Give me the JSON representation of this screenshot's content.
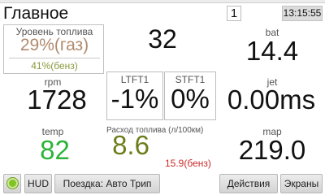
{
  "header": {
    "title": "Главное",
    "page_number": "1",
    "time": "13:15:55"
  },
  "fuel_level": {
    "label": "Уровень топлива",
    "gas_value": "29%(газ)",
    "petrol_value": "41%(бенз)"
  },
  "center_top": {
    "value": "32"
  },
  "bat": {
    "label": "bat",
    "value": "14.4"
  },
  "rpm": {
    "label": "rpm",
    "value": "1728"
  },
  "ltft1": {
    "label": "LTFT1",
    "value": "-1%"
  },
  "stft1": {
    "label": "STFT1",
    "value": "0%"
  },
  "jet": {
    "label": "jet",
    "value": "0.00ms"
  },
  "temp": {
    "label": "temp",
    "value": "82"
  },
  "fuel_consumption": {
    "label": "Расход топлива (л/100км)",
    "value": "8.6",
    "petrol_value": "15.9(бенз)"
  },
  "map": {
    "label": "map",
    "value": "219.0"
  },
  "toolbar": {
    "hud_label": "HUD",
    "trip_label": "Поездка: Авто Трип",
    "actions_label": "Действия",
    "screens_label": "Экраны"
  },
  "colors": {
    "temp_value": "#2db33a",
    "consumption_value": "#6c7d1b",
    "consumption_petrol": "#cc2a2a",
    "fuel_gas": "#b08a6e",
    "fuel_petrol": "#8a9a3c",
    "status_indicator": "#7fc324"
  }
}
